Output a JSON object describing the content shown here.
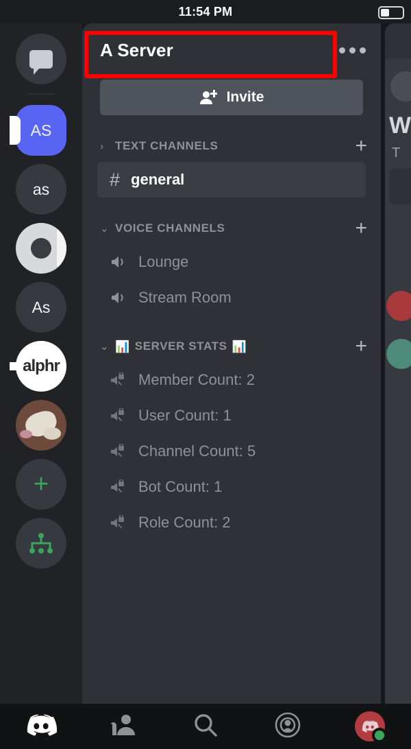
{
  "status_bar": {
    "time": "11:54 PM",
    "battery_icon": "battery-icon"
  },
  "server_rail": {
    "home_icon": "direct-messages-icon",
    "servers": [
      {
        "label": "AS",
        "type": "initials",
        "selected": true
      },
      {
        "label": "as",
        "type": "initials",
        "selected": false
      },
      {
        "label": "",
        "type": "donut-logo",
        "selected": false
      },
      {
        "label": "As",
        "type": "initials",
        "selected": false
      },
      {
        "label": "alphr",
        "type": "wordmark-logo",
        "selected": false
      },
      {
        "label": "",
        "type": "photo-avatar",
        "selected": false
      }
    ],
    "add_server_label": "+",
    "add_server_icon": "plus-icon",
    "explore_icon": "compass-explore-icon"
  },
  "sidebar": {
    "server_name": "A Server",
    "overflow_icon": "three-dots-icon",
    "invite": {
      "label": "Invite",
      "icon": "add-person-icon"
    },
    "categories": [
      {
        "title": "TEXT CHANNELS",
        "collapsed": true,
        "chevron": "›",
        "add_icon": "plus-icon",
        "emoji_left": "",
        "emoji_right": "",
        "channels": [
          {
            "name": "general",
            "icon": "hash-icon",
            "active": true,
            "locked": false
          }
        ]
      },
      {
        "title": "VOICE CHANNELS",
        "collapsed": false,
        "chevron": "⌄",
        "add_icon": "plus-icon",
        "emoji_left": "",
        "emoji_right": "",
        "channels": [
          {
            "name": "Lounge",
            "icon": "speaker-icon",
            "active": false,
            "locked": false
          },
          {
            "name": "Stream Room",
            "icon": "speaker-icon",
            "active": false,
            "locked": false
          }
        ]
      },
      {
        "title": "SERVER STATS",
        "collapsed": false,
        "chevron": "⌄",
        "add_icon": "plus-icon",
        "emoji_left": "📊",
        "emoji_right": "📊",
        "channels": [
          {
            "name": "Member Count: 2",
            "icon": "locked-speaker-icon",
            "active": false,
            "locked": true
          },
          {
            "name": "User Count: 1",
            "icon": "locked-speaker-icon",
            "active": false,
            "locked": true
          },
          {
            "name": "Channel Count: 5",
            "icon": "locked-speaker-icon",
            "active": false,
            "locked": true
          },
          {
            "name": "Bot Count: 1",
            "icon": "locked-speaker-icon",
            "active": false,
            "locked": true
          },
          {
            "name": "Role Count: 2",
            "icon": "locked-speaker-icon",
            "active": false,
            "locked": true
          }
        ]
      }
    ]
  },
  "chat_peek": {
    "heading": "W",
    "subtext": "T"
  },
  "bottom_nav": {
    "items": [
      {
        "icon": "discord-home-icon",
        "label": ""
      },
      {
        "icon": "friends-icon",
        "label": ""
      },
      {
        "icon": "search-icon",
        "label": ""
      },
      {
        "icon": "mentions-inbox-icon",
        "label": ""
      },
      {
        "icon": "user-avatar-icon",
        "label": ""
      }
    ],
    "presence": "online"
  },
  "annotation": {
    "color": "#ff0000",
    "target": "server-name-header"
  },
  "colors": {
    "rail_bg": "#202225",
    "sidebar_bg": "#2f3136",
    "chat_bg": "#36393f",
    "accent_blurple": "#5865f2",
    "online_green": "#3ba55d",
    "muted_text": "#8e9297",
    "highlight_red": "#ff0000"
  }
}
